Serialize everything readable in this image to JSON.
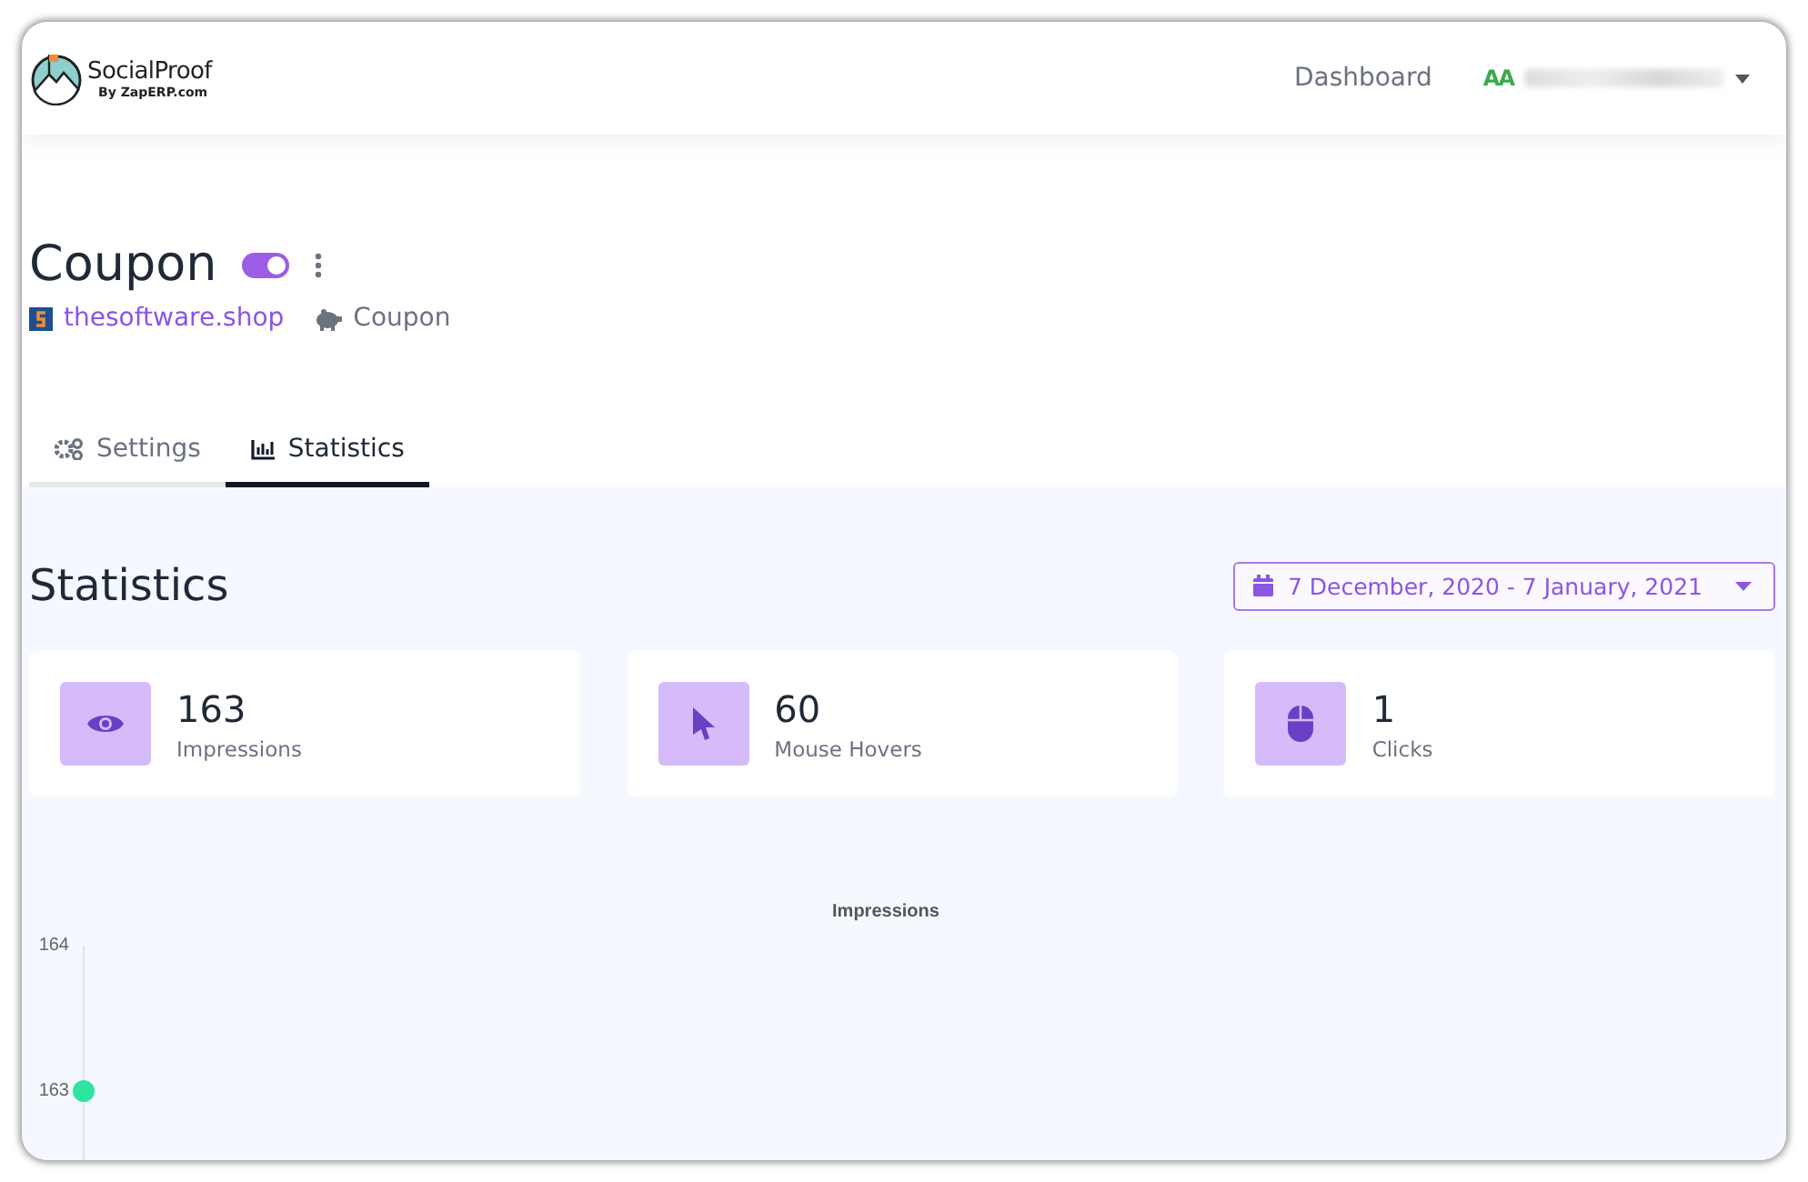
{
  "header": {
    "logo_title": "SocialProof",
    "logo_subtitle": "By ZapERP.com",
    "nav": [
      "Dashboard"
    ],
    "user": {
      "initials": "AA"
    }
  },
  "campaign": {
    "title": "Coupon",
    "enabled": true,
    "site": "thesoftware.shop",
    "type": "Coupon"
  },
  "tabs": [
    {
      "label": "Settings",
      "kind": "settings",
      "selected": false
    },
    {
      "label": "Statistics",
      "kind": "statistics",
      "selected": true
    }
  ],
  "statistics": {
    "heading": "Statistics",
    "date_range": "7 December, 2020 - 7 January, 2021",
    "cards": [
      {
        "kind": "impressions",
        "value": "163",
        "label": "Impressions"
      },
      {
        "kind": "hovers",
        "value": "60",
        "label": "Mouse Hovers"
      },
      {
        "kind": "clicks",
        "value": "1",
        "label": "Clicks"
      }
    ],
    "chart": {
      "title": "Impressions",
      "axis_labels": [
        "164",
        "163"
      ]
    }
  }
}
